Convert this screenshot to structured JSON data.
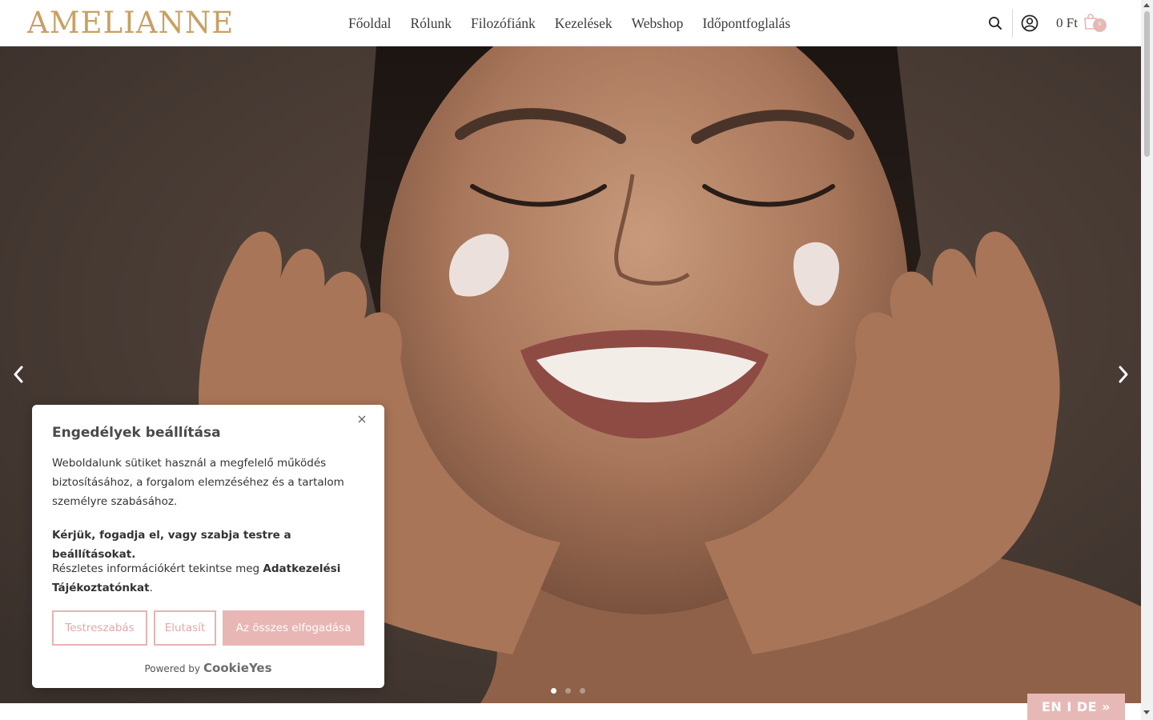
{
  "header": {
    "logo": "AMELIANNE",
    "nav": [
      "Főoldal",
      "Rólunk",
      "Filozófiánk",
      "Kezelések",
      "Webshop",
      "Időpontfoglalás"
    ],
    "cart_total": "0 Ft",
    "cart_count": "0",
    "icons": [
      "search-icon",
      "user-icon",
      "cart-icon"
    ]
  },
  "hero": {
    "slides_count": 3,
    "active_slide": 1,
    "image": "smiling woman with face cream on cheeks"
  },
  "cookie": {
    "title": "Engedélyek beállítása",
    "text1": "Weboldalunk sütiket használ a megfelelő működés biztosításához, a forgalom elemzéséhez és a tartalom személyre szabásához.",
    "text2": "Kérjük, fogadja el, vagy szabja testre a beállításokat.",
    "text3_prefix": "Részletes információkért tekintse meg ",
    "text3_link": "Adatkezelési Tájékoztatónkat",
    "text3_suffix": ".",
    "btn_customize": "Testreszabás",
    "btn_reject": "Elutasít",
    "btn_accept": "Az összes elfogadása",
    "powered_by": "Powered by",
    "powered_brand": "CookieYes"
  },
  "lang_switch": "EN I DE »",
  "colors": {
    "accent_pink": "#e8b6b4",
    "logo_gold": "#c9a063",
    "text_dark": "#3c3c3c"
  }
}
